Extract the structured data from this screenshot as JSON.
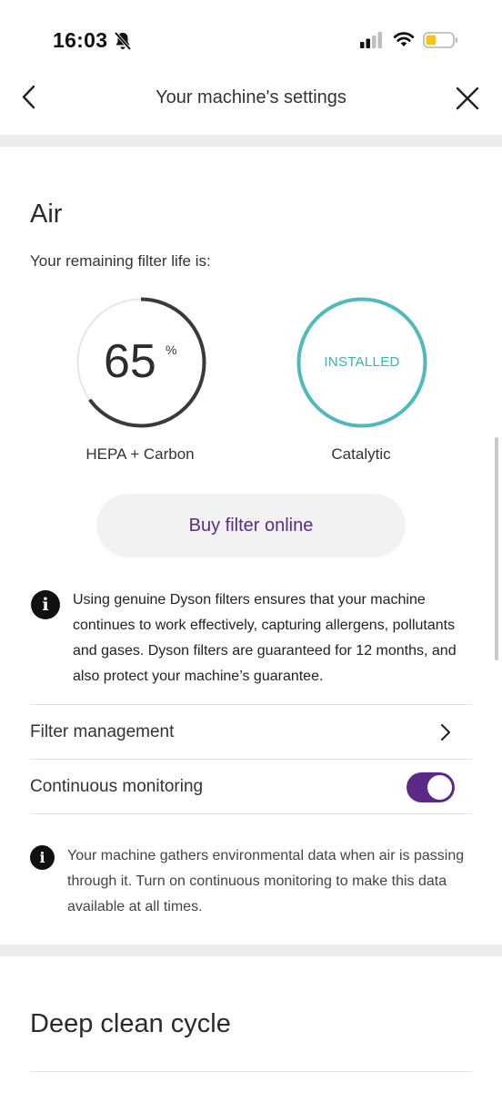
{
  "status_bar": {
    "time": "16:03",
    "icons": [
      "bell-slash-icon",
      "cellular-signal-icon",
      "wifi-icon",
      "battery-icon"
    ]
  },
  "nav": {
    "title": "Your machine's settings",
    "back_icon": "chevron-left-icon",
    "close_icon": "close-icon"
  },
  "air": {
    "section_title": "Air",
    "filter_life_label": "Your remaining filter life is:",
    "hepa": {
      "value": "65",
      "unit": "%",
      "level": 0.65,
      "caption": "HEPA + Carbon"
    },
    "catalytic": {
      "status": "INSTALLED",
      "caption": "Catalytic"
    },
    "buy_button_label": "Buy filter online",
    "info_message": "Using genuine Dyson filters ensures that your machine continues to work effectively, capturing allergens, pollutants and gases. Dyson filters are guaranteed for 12 months, and also protect your machine’s guarantee.",
    "filter_management_label": "Filter management",
    "continuous_monitoring_label": "Continuous monitoring",
    "continuous_monitoring_on": true,
    "monitoring_info": "Your machine gathers environmental data when air is passing through it. Turn on continuous monitoring to make this data available at all times."
  },
  "deep_clean": {
    "section_title": "Deep clean cycle"
  },
  "colors": {
    "accent_purple": "#5b2a86",
    "installed_teal": "#4fb9bc",
    "gauge_dark": "#3a3a3a",
    "gauge_track": "#e6e6e6",
    "battery_yellow": "#f5c518"
  }
}
